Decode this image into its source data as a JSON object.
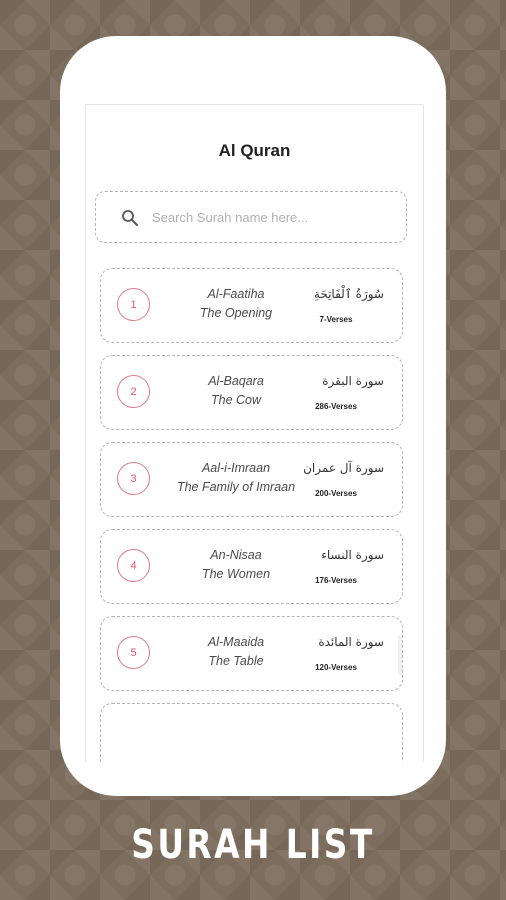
{
  "header": {
    "title": "Al Quran"
  },
  "search": {
    "placeholder": "Search Surah name here...",
    "icon": "search-icon"
  },
  "surahs": [
    {
      "number": "1",
      "transliteration": "Al-Faatiha",
      "translation": "The Opening",
      "arabic": "سُورَةُ ٱلْفَاتِحَةِ",
      "verses": "7-Verses"
    },
    {
      "number": "2",
      "transliteration": "Al-Baqara",
      "translation": "The Cow",
      "arabic": "سورة البقرة",
      "verses": "286-Verses"
    },
    {
      "number": "3",
      "transliteration": "Aal-i-Imraan",
      "translation": "The Family of Imraan",
      "arabic": "سورة آل عمران",
      "verses": "200-Verses"
    },
    {
      "number": "4",
      "transliteration": "An-Nisaa",
      "translation": "The Women",
      "arabic": "سورة النساء",
      "verses": "176-Verses"
    },
    {
      "number": "5",
      "transliteration": "Al-Maaida",
      "translation": "The Table",
      "arabic": "سورة المائدة",
      "verses": "120-Verses"
    }
  ],
  "footer": {
    "label": "SURAH LIST"
  },
  "colors": {
    "background": "#7d6d5d",
    "accent": "#e0566f",
    "card_border": "#b4b4b4"
  }
}
